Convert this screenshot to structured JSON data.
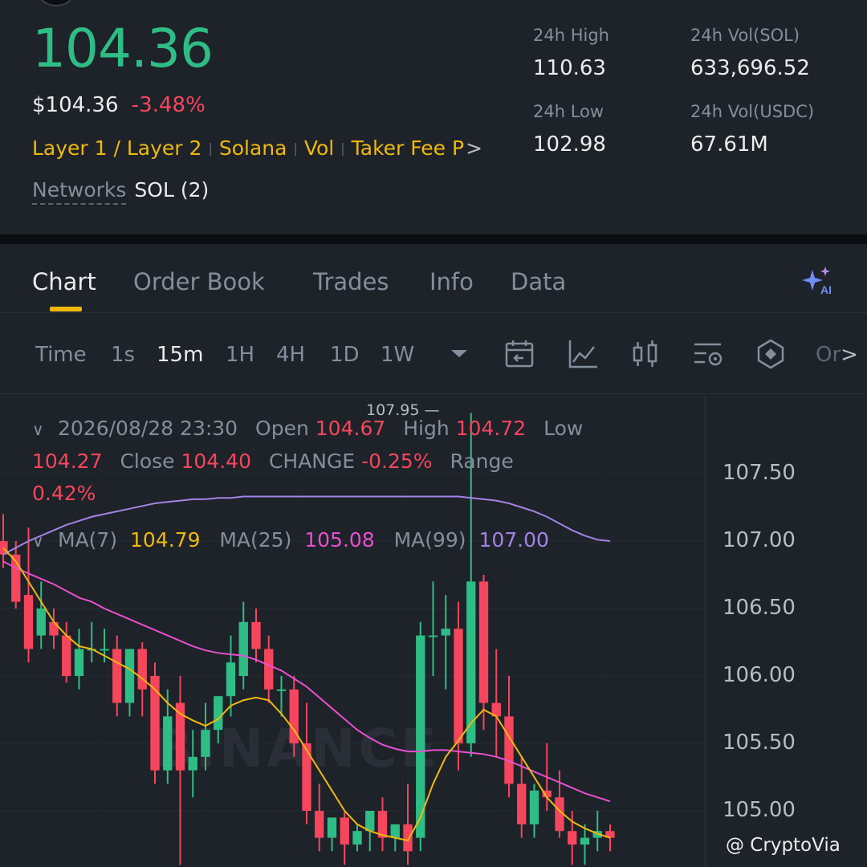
{
  "ticker": {
    "last_price": "104.36",
    "fiat_price": "$104.36",
    "change_pct": "-3.48%",
    "tags": [
      "Layer 1 / Layer 2",
      "Solana",
      "Vol",
      "Taker Fee P"
    ],
    "networks_label": "Networks",
    "networks_value": "SOL (2)"
  },
  "stats": {
    "high_label": "24h High",
    "high_value": "110.63",
    "low_label": "24h Low",
    "low_value": "102.98",
    "vol_base_label": "24h Vol(SOL)",
    "vol_base_value": "633,696.52",
    "vol_quote_label": "24h Vol(USDC)",
    "vol_quote_value": "67.61M"
  },
  "tabs": [
    {
      "label": "Chart",
      "active": true
    },
    {
      "label": "Order Book",
      "active": false
    },
    {
      "label": "Trades",
      "active": false
    },
    {
      "label": "Info",
      "active": false
    },
    {
      "label": "Data",
      "active": false
    }
  ],
  "timeframes": {
    "time": "Time",
    "t1s": "1s",
    "t15m": "15m",
    "t1h": "1H",
    "t4h": "4H",
    "t1d": "1D",
    "t1w": "1W",
    "active": "15m"
  },
  "tools": {
    "more": "Or",
    "icons": [
      "calendar-back-icon",
      "indicator-line-icon",
      "candle-type-icon",
      "chart-settings-icon",
      "drawing-tool-icon"
    ]
  },
  "ohlc": {
    "datetime": "2026/08/28 23:30",
    "open_label": "Open",
    "open": "104.67",
    "high_label": "High",
    "high": "104.72",
    "low_label": "Low",
    "low": "104.27",
    "close_label": "Close",
    "close": "104.40",
    "change_label": "CHANGE",
    "change": "-0.25%",
    "range_label": "Range",
    "range": "0.42%"
  },
  "ma": {
    "ma7_label": "MA(7)",
    "ma7": "104.79",
    "ma25_label": "MA(25)",
    "ma25": "105.08",
    "ma99_label": "MA(99)",
    "ma99": "107.00"
  },
  "y_axis": [
    "107.50",
    "107.00",
    "106.50",
    "106.00",
    "105.50",
    "105.00"
  ],
  "peak_label": "107.95",
  "watermark": "BINANCE",
  "credit": "@ CryptoVia",
  "colors": {
    "up": "#2ebd85",
    "down": "#f6465d",
    "accent": "#f0b90b",
    "ma7": "#f0b90b",
    "ma25": "#e84fcf",
    "ma99": "#a383e6",
    "bg": "#1e2229"
  },
  "chart_data": {
    "type": "candlestick",
    "y_range": [
      104.6,
      107.95
    ],
    "candles": [
      {
        "o": 107.0,
        "h": 107.2,
        "c": 106.9,
        "l": 106.8
      },
      {
        "o": 106.9,
        "h": 107.0,
        "c": 106.55,
        "l": 106.5
      },
      {
        "o": 106.6,
        "h": 107.1,
        "c": 106.2,
        "l": 106.1
      },
      {
        "o": 106.3,
        "h": 106.7,
        "c": 106.5,
        "l": 106.2
      },
      {
        "o": 106.4,
        "h": 106.5,
        "c": 106.3,
        "l": 106.2
      },
      {
        "o": 106.3,
        "h": 106.4,
        "c": 106.0,
        "l": 105.95
      },
      {
        "o": 106.0,
        "h": 106.35,
        "c": 106.2,
        "l": 105.9
      },
      {
        "o": 106.2,
        "h": 106.4,
        "c": 106.2,
        "l": 106.1
      },
      {
        "o": 106.2,
        "h": 106.35,
        "c": 106.2,
        "l": 106.1
      },
      {
        "o": 106.2,
        "h": 106.3,
        "c": 105.8,
        "l": 105.7
      },
      {
        "o": 105.8,
        "h": 106.2,
        "c": 106.2,
        "l": 105.7
      },
      {
        "o": 106.2,
        "h": 106.25,
        "c": 105.9,
        "l": 105.7
      },
      {
        "o": 106.0,
        "h": 106.1,
        "c": 105.3,
        "l": 105.2
      },
      {
        "o": 105.3,
        "h": 105.9,
        "c": 105.7,
        "l": 105.2
      },
      {
        "o": 105.8,
        "h": 106.0,
        "c": 105.3,
        "l": 104.6
      },
      {
        "o": 105.3,
        "h": 105.6,
        "c": 105.4,
        "l": 105.1
      },
      {
        "o": 105.4,
        "h": 105.8,
        "c": 105.6,
        "l": 105.3
      },
      {
        "o": 105.6,
        "h": 105.8,
        "c": 105.85,
        "l": 105.5
      },
      {
        "o": 105.85,
        "h": 106.3,
        "c": 106.1,
        "l": 105.7
      },
      {
        "o": 106.0,
        "h": 106.55,
        "c": 106.4,
        "l": 105.9
      },
      {
        "o": 106.4,
        "h": 106.5,
        "c": 106.2,
        "l": 106.1
      },
      {
        "o": 106.2,
        "h": 106.3,
        "c": 105.9,
        "l": 105.8
      },
      {
        "o": 105.9,
        "h": 106.0,
        "c": 105.9,
        "l": 105.7
      },
      {
        "o": 105.9,
        "h": 106.0,
        "c": 105.5,
        "l": 105.4
      },
      {
        "o": 105.5,
        "h": 105.8,
        "c": 105.0,
        "l": 104.9
      },
      {
        "o": 105.0,
        "h": 105.2,
        "c": 104.8,
        "l": 104.7
      },
      {
        "o": 104.8,
        "h": 104.9,
        "c": 104.95,
        "l": 104.7
      },
      {
        "o": 104.95,
        "h": 105.0,
        "c": 104.75,
        "l": 104.6
      },
      {
        "o": 104.75,
        "h": 104.9,
        "c": 104.85,
        "l": 104.7
      },
      {
        "o": 104.85,
        "h": 105.0,
        "c": 105.0,
        "l": 104.7
      },
      {
        "o": 105.0,
        "h": 105.1,
        "c": 104.8,
        "l": 104.7
      },
      {
        "o": 104.8,
        "h": 104.9,
        "c": 104.9,
        "l": 104.7
      },
      {
        "o": 104.9,
        "h": 105.2,
        "c": 104.7,
        "l": 104.6
      },
      {
        "o": 104.8,
        "h": 106.4,
        "c": 106.3,
        "l": 104.7
      },
      {
        "o": 106.3,
        "h": 106.7,
        "c": 106.3,
        "l": 106.0
      },
      {
        "o": 106.3,
        "h": 106.6,
        "c": 106.35,
        "l": 105.9
      },
      {
        "o": 106.35,
        "h": 106.55,
        "c": 105.5,
        "l": 105.3
      },
      {
        "o": 105.5,
        "h": 107.95,
        "c": 106.7,
        "l": 105.4
      },
      {
        "o": 106.7,
        "h": 106.75,
        "c": 105.8,
        "l": 105.6
      },
      {
        "o": 105.8,
        "h": 106.2,
        "c": 105.7,
        "l": 105.4
      },
      {
        "o": 105.7,
        "h": 106.0,
        "c": 105.2,
        "l": 105.1
      },
      {
        "o": 105.2,
        "h": 105.4,
        "c": 104.9,
        "l": 104.8
      },
      {
        "o": 104.9,
        "h": 105.2,
        "c": 105.15,
        "l": 104.8
      },
      {
        "o": 105.15,
        "h": 105.5,
        "c": 105.1,
        "l": 105.0
      },
      {
        "o": 105.1,
        "h": 105.3,
        "c": 104.85,
        "l": 104.8
      },
      {
        "o": 104.85,
        "h": 105.0,
        "c": 104.75,
        "l": 104.6
      },
      {
        "o": 104.75,
        "h": 104.9,
        "c": 104.8,
        "l": 104.6
      },
      {
        "o": 104.8,
        "h": 105.0,
        "c": 104.85,
        "l": 104.7
      },
      {
        "o": 104.85,
        "h": 104.9,
        "c": 104.8,
        "l": 104.7
      }
    ],
    "ma7": [
      106.95,
      106.85,
      106.7,
      106.55,
      106.4,
      106.3,
      106.22,
      106.2,
      106.15,
      106.1,
      106.05,
      105.98,
      105.9,
      105.8,
      105.72,
      105.67,
      105.63,
      105.68,
      105.78,
      105.82,
      105.84,
      105.82,
      105.72,
      105.6,
      105.45,
      105.3,
      105.15,
      105.0,
      104.9,
      104.85,
      104.82,
      104.8,
      104.78,
      104.95,
      105.2,
      105.4,
      105.52,
      105.65,
      105.75,
      105.7,
      105.55,
      105.4,
      105.25,
      105.1,
      105.0,
      104.92,
      104.87,
      104.83,
      104.8
    ],
    "ma25": [
      106.85,
      106.8,
      106.76,
      106.72,
      106.68,
      106.63,
      106.58,
      106.55,
      106.5,
      106.46,
      106.42,
      106.38,
      106.34,
      106.3,
      106.26,
      106.22,
      106.19,
      106.17,
      106.16,
      106.15,
      106.12,
      106.08,
      106.04,
      105.98,
      105.92,
      105.84,
      105.76,
      105.68,
      105.6,
      105.54,
      105.49,
      105.46,
      105.44,
      105.44,
      105.45,
      105.45,
      105.44,
      105.43,
      105.42,
      105.4,
      105.37,
      105.33,
      105.29,
      105.25,
      105.21,
      105.17,
      105.13,
      105.1,
      105.07
    ],
    "ma99": [
      106.9,
      106.95,
      107.0,
      107.04,
      107.08,
      107.12,
      107.15,
      107.18,
      107.2,
      107.22,
      107.24,
      107.26,
      107.28,
      107.29,
      107.3,
      107.31,
      107.31,
      107.32,
      107.32,
      107.33,
      107.33,
      107.33,
      107.33,
      107.33,
      107.33,
      107.33,
      107.33,
      107.33,
      107.33,
      107.33,
      107.33,
      107.33,
      107.33,
      107.33,
      107.33,
      107.33,
      107.33,
      107.32,
      107.31,
      107.3,
      107.28,
      107.25,
      107.22,
      107.18,
      107.13,
      107.08,
      107.04,
      107.01,
      107.0
    ]
  }
}
